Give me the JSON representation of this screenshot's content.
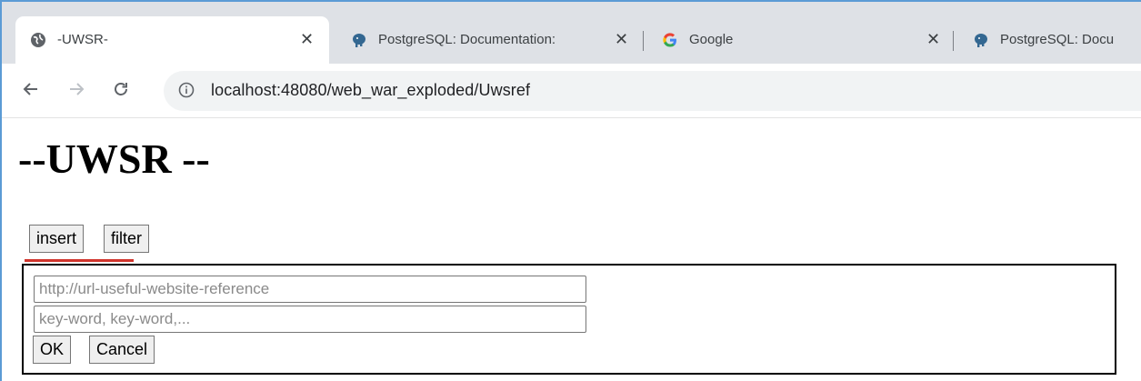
{
  "browser": {
    "tabs": [
      {
        "title": "-UWSR-",
        "icon": "globe-icon"
      },
      {
        "title": "PostgreSQL: Documentation:",
        "icon": "postgresql-elephant-icon"
      },
      {
        "title": "Google",
        "icon": "google-g-icon"
      },
      {
        "title": "PostgreSQL: Docu",
        "icon": "postgresql-elephant-icon"
      }
    ],
    "close_glyph": "✕",
    "address": "localhost:48080/web_war_exploded/Uwsref",
    "colors": {
      "tabstrip": "#dee1e6",
      "accent_red": "#d0342c",
      "frame": "#5b9bd5"
    }
  },
  "page": {
    "title": "--UWSR --",
    "mode_buttons": {
      "insert": "insert",
      "filter": "filter"
    },
    "form": {
      "url_placeholder": "http://url-useful-website-reference",
      "keywords_placeholder": "key-word, key-word,...",
      "ok_label": "OK",
      "cancel_label": "Cancel"
    }
  }
}
